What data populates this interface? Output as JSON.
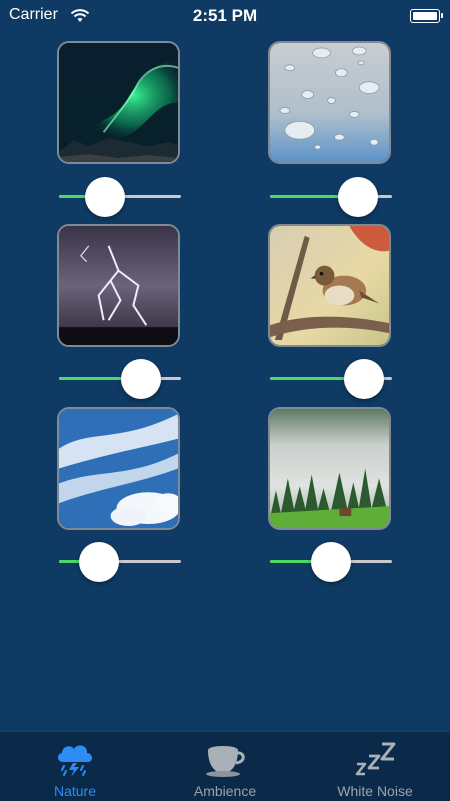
{
  "status_bar": {
    "carrier": "Carrier",
    "time": "2:51 PM"
  },
  "sounds": [
    {
      "name": "aurora",
      "volume": 0.38
    },
    {
      "name": "rain-drops",
      "volume": 0.72
    },
    {
      "name": "thunderstorm",
      "volume": 0.67
    },
    {
      "name": "bird",
      "volume": 0.77
    },
    {
      "name": "wind-clouds",
      "volume": 0.33
    },
    {
      "name": "forest-fog",
      "volume": 0.5
    }
  ],
  "tab_bar": {
    "tabs": [
      {
        "label": "Nature",
        "icon": "storm-cloud-icon",
        "active": true
      },
      {
        "label": "Ambience",
        "icon": "coffee-cup-icon",
        "active": false
      },
      {
        "label": "White Noise",
        "icon": "zzz-icon",
        "active": false
      }
    ]
  },
  "colors": {
    "background": "#0f3a63",
    "tab_bar": "#0b2a49",
    "slider_fill": "#4cd964",
    "slider_track": "#c9c9c9",
    "active_tab": "#2e8df5",
    "inactive_tab": "#9aa3ad"
  }
}
